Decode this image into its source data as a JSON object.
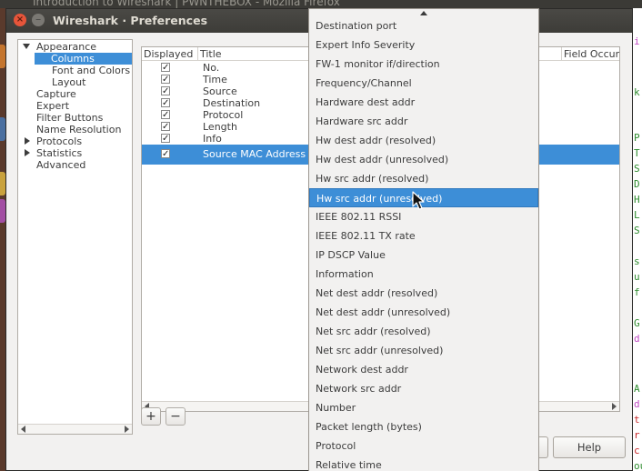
{
  "background": {
    "top_title": "Introduction to Wireshark | PWNTHEBOX - Mozilla Firefox",
    "right_fragments": [
      "i",
      "k",
      "P",
      "T",
      "S",
      "D",
      "H",
      "L",
      "S",
      "s",
      "u",
      "f",
      "G",
      "d",
      "A",
      "d",
      "t",
      "r",
      "c",
      "our"
    ]
  },
  "window": {
    "title": "Wireshark · Preferences",
    "close_glyph": "×",
    "min_glyph": "−"
  },
  "tree": {
    "items": [
      {
        "label": "Appearance"
      },
      {
        "label": "Columns"
      },
      {
        "label": "Font and Colors"
      },
      {
        "label": "Layout"
      },
      {
        "label": "Capture"
      },
      {
        "label": "Expert"
      },
      {
        "label": "Filter Buttons"
      },
      {
        "label": "Name Resolution"
      },
      {
        "label": "Protocols"
      },
      {
        "label": "Statistics"
      },
      {
        "label": "Advanced"
      }
    ],
    "selected": "Columns"
  },
  "columns_table": {
    "headers": {
      "displayed": "Displayed",
      "title": "Title",
      "field_occurrence": "Field Occur"
    },
    "check_glyph": "✓",
    "rows": [
      {
        "title": "No."
      },
      {
        "title": "Time"
      },
      {
        "title": "Source"
      },
      {
        "title": "Destination"
      },
      {
        "title": "Protocol"
      },
      {
        "title": "Length"
      },
      {
        "title": "Info"
      },
      {
        "title": "Source MAC Address"
      }
    ],
    "selected_row": "Source MAC Address"
  },
  "controls": {
    "add": "+",
    "remove": "−",
    "help": "Help"
  },
  "dropdown": {
    "items": [
      "Destination port",
      "Expert Info Severity",
      "FW-1 monitor if/direction",
      "Frequency/Channel",
      "Hardware dest addr",
      "Hardware src addr",
      "Hw dest addr (resolved)",
      "Hw dest addr (unresolved)",
      "Hw src addr (resolved)",
      "Hw src addr (unresolved)",
      "IEEE 802.11 RSSI",
      "IEEE 802.11 TX rate",
      "IP DSCP Value",
      "Information",
      "Net dest addr (resolved)",
      "Net dest addr (unresolved)",
      "Net src addr (resolved)",
      "Net src addr (unresolved)",
      "Network dest addr",
      "Network src addr",
      "Number",
      "Packet length (bytes)",
      "Protocol",
      "Relative time"
    ],
    "highlighted": "Hw src addr (unresolved)"
  },
  "colors": {
    "selection": "#3d8ed7",
    "titlebar": "#3d3c38",
    "close_button": "#e7553a"
  }
}
